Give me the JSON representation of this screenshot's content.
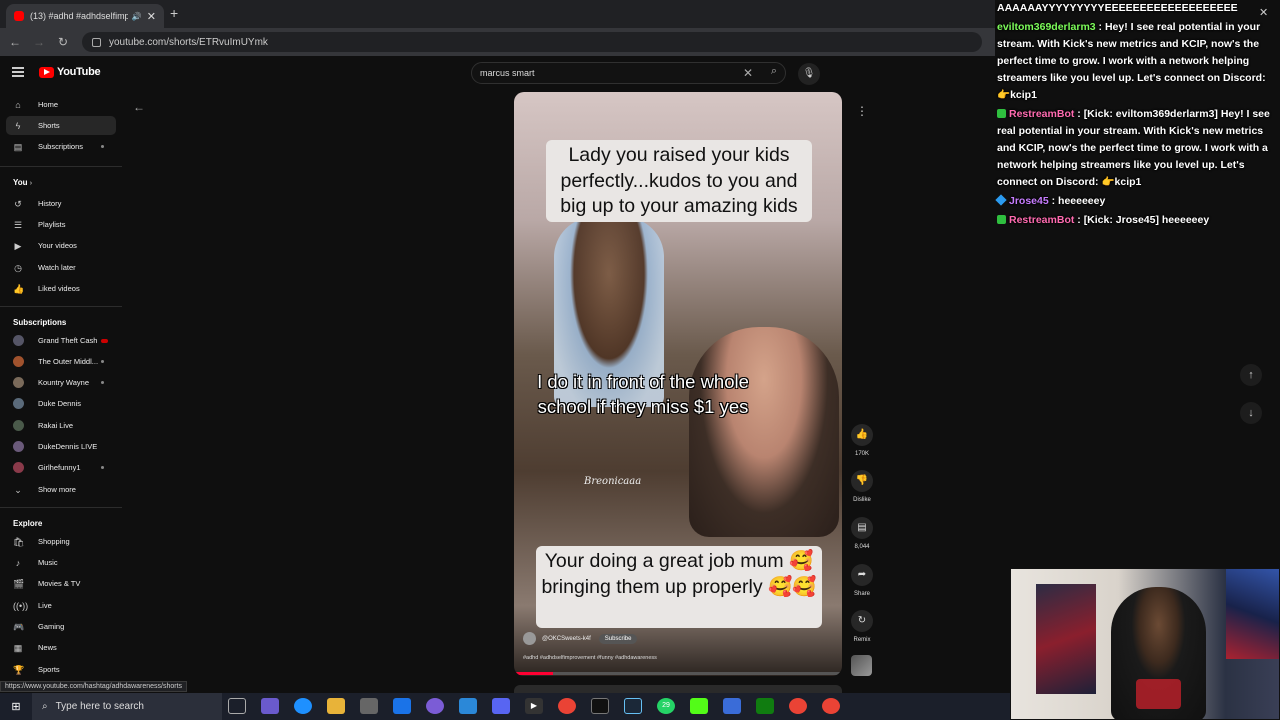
{
  "browser": {
    "tab_title": "(13) #adhd #adhdselfimpro",
    "url": "youtube.com/shorts/ETRvuImUYmk",
    "status_url": "https://www.youtube.com/hashtag/adhdawareness/shorts"
  },
  "youtube": {
    "logo_text": "YouTube",
    "search_value": "marcus smart"
  },
  "sidebar": {
    "items": [
      {
        "label": "Home",
        "icon": "home-icon"
      },
      {
        "label": "Shorts",
        "icon": "shorts-icon"
      },
      {
        "label": "Subscriptions",
        "icon": "subscriptions-icon"
      }
    ],
    "you_header": "You",
    "you_items": [
      {
        "label": "History",
        "icon": "history-icon"
      },
      {
        "label": "Playlists",
        "icon": "playlists-icon"
      },
      {
        "label": "Your videos",
        "icon": "your-videos-icon"
      },
      {
        "label": "Watch later",
        "icon": "watch-later-icon"
      },
      {
        "label": "Liked videos",
        "icon": "liked-videos-icon"
      }
    ],
    "subs_header": "Subscriptions",
    "subscriptions": [
      {
        "label": "Grand Theft Cash"
      },
      {
        "label": "The Outer Middl..."
      },
      {
        "label": "Kountry Wayne"
      },
      {
        "label": "Duke Dennis"
      },
      {
        "label": "Rakai Live"
      },
      {
        "label": "DukeDennis LIVE"
      },
      {
        "label": "Girlhefunny1"
      }
    ],
    "show_more": "Show more",
    "explore_header": "Explore",
    "explore_items": [
      {
        "label": "Shopping",
        "icon": "shopping-icon"
      },
      {
        "label": "Music",
        "icon": "music-icon"
      },
      {
        "label": "Movies & TV",
        "icon": "movies-icon"
      },
      {
        "label": "Live",
        "icon": "live-icon"
      },
      {
        "label": "Gaming",
        "icon": "gaming-icon"
      },
      {
        "label": "News",
        "icon": "news-icon"
      },
      {
        "label": "Sports",
        "icon": "sports-icon"
      }
    ]
  },
  "short": {
    "caption_top": "Lady you raised your kids perfectly...kudos to you and big up to your amazing kids",
    "caption_mid": "I do it in front of the whole school if they miss $1 yes",
    "watermark": "Breonicaaa",
    "caption_bottom": "Your doing a great job mum 🥰 bringing them up properly 🥰🥰",
    "channel": "@OKCSweets-k4f",
    "subscribe_label": "Subscribe",
    "hashtags": "#adhd #adhdselfimprovement #funny #adhdawareness",
    "progress": 0.12
  },
  "actions": {
    "likes": "170K",
    "dislike": "Dislike",
    "comments": "8,044",
    "share": "Share",
    "remix": "Remix"
  },
  "chat": [
    {
      "type": "plain",
      "text": "AAAAAAYYYYYYYYYEEEEEEEEEEEEEEEEEEE"
    },
    {
      "type": "msg",
      "user": "eviltom369derlarm3",
      "color": "green",
      "badge": "none",
      "text": " : Hey! I see real potential in your stream. With Kick's new metrics and KCIP, now's the perfect time to grow. I work with a network helping streamers like you level up. Let's connect on Discord: ",
      "emote": "👉",
      "tail": "kcip1"
    },
    {
      "type": "msg",
      "user": "RestreamBot",
      "color": "pink",
      "badge": "check",
      "text": " : [Kick: eviltom369derlarm3] Hey! I see real potential in your stream. With Kick's new metrics and KCIP, now's the perfect time to grow. I work with a network helping streamers like you level up. Let's connect on Discord: ",
      "emote": "👉",
      "tail": "kcip1"
    },
    {
      "type": "msg",
      "user": "Jrose45",
      "color": "violet",
      "badge": "cube",
      "text": " : heeeeeey",
      "emote": "",
      "tail": ""
    },
    {
      "type": "msg",
      "user": "RestreamBot",
      "color": "pink",
      "badge": "check",
      "text": " : [Kick: Jrose45] heeeeeey",
      "emote": "",
      "tail": ""
    }
  ],
  "taskbar": {
    "search_placeholder": "Type here to search",
    "badge_count": "29"
  },
  "colors": {
    "youtube_red": "#ff0000",
    "chat_green": "#7cfc5a",
    "chat_pink": "#ff6bb0",
    "chat_violet": "#c77dff"
  }
}
